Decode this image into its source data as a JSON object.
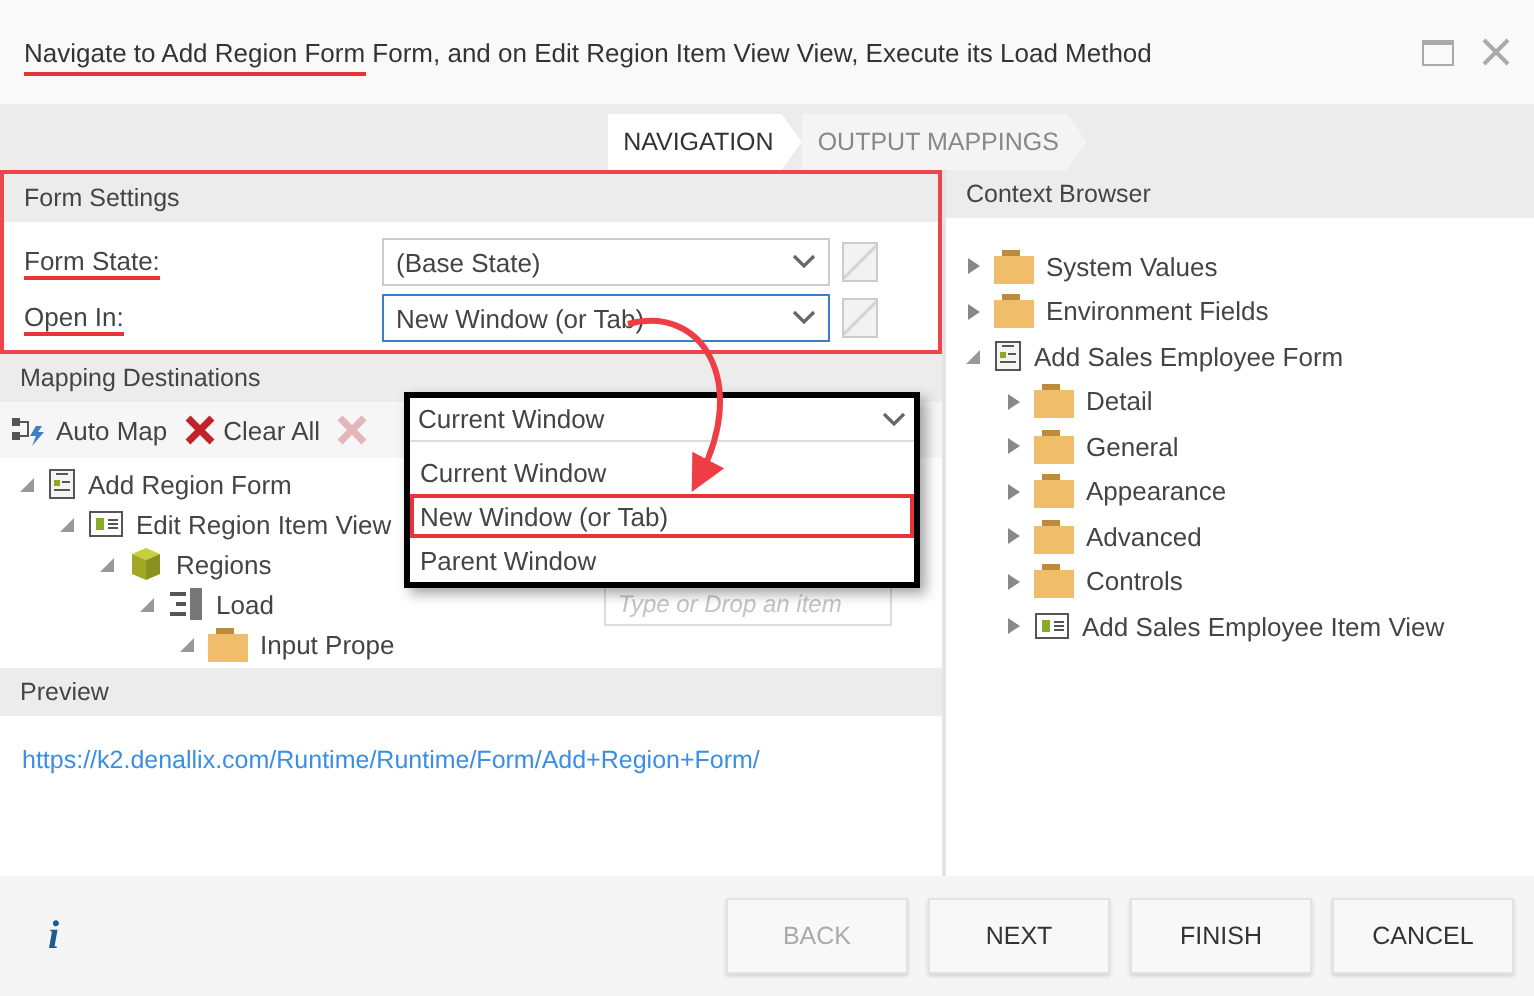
{
  "window": {
    "title_marked": "Navigate to Add Region Form",
    "title_rest": " Form, and on Edit Region Item View View, Execute its Load Method"
  },
  "steps": [
    {
      "label": "NAVIGATION",
      "selected": true
    },
    {
      "label": "OUTPUT MAPPINGS",
      "selected": false
    }
  ],
  "form_settings": {
    "title": "Form Settings",
    "highlighted": true,
    "fields": [
      {
        "label": "Form State:",
        "value": "(Base State)",
        "focused": false,
        "underlined": true
      },
      {
        "label": "Open In:",
        "value": "New Window (or Tab)",
        "focused": true,
        "underlined": true
      }
    ]
  },
  "dropdown": {
    "value": "Current Window",
    "options": [
      {
        "label": "Current Window",
        "highlighted": false
      },
      {
        "label": "New Window (or Tab)",
        "highlighted": true
      },
      {
        "label": "Parent Window",
        "highlighted": false
      }
    ]
  },
  "mapping": {
    "title": "Mapping Destinations",
    "toolbar": [
      {
        "label": "Auto Map",
        "kind": "automap",
        "disabled": false
      },
      {
        "label": "Clear All",
        "kind": "clear",
        "disabled": false
      },
      {
        "kind": "remove",
        "disabled": true
      }
    ],
    "tree": [
      {
        "label": "Add Region Form",
        "kind": "form",
        "children": [
          {
            "label": "Edit Region Item View",
            "kind": "view",
            "children": [
              {
                "label": "Regions",
                "kind": "object",
                "children": [
                  {
                    "label": "Load",
                    "kind": "method",
                    "children": [
                      {
                        "label": "Input Prope",
                        "kind": "folder"
                      }
                    ]
                  }
                ]
              }
            ]
          }
        ]
      }
    ],
    "drop_placeholder": "Type or Drop an item"
  },
  "preview": {
    "title": "Preview",
    "url": "https://k2.denallix.com/Runtime/Runtime/Form/Add+Region+Form/"
  },
  "context": {
    "title": "Context Browser",
    "tree": [
      {
        "label": "System Values",
        "kind": "folder",
        "expanded": false
      },
      {
        "label": "Environment Fields",
        "kind": "folder",
        "expanded": false
      },
      {
        "label": "Add Sales Employee Form",
        "kind": "form",
        "expanded": true,
        "children": [
          {
            "label": "Detail",
            "kind": "folder",
            "expanded": false
          },
          {
            "label": "General",
            "kind": "folder",
            "expanded": false
          },
          {
            "label": "Appearance",
            "kind": "folder",
            "expanded": false
          },
          {
            "label": "Advanced",
            "kind": "folder",
            "expanded": false
          },
          {
            "label": "Controls",
            "kind": "folder",
            "expanded": false
          },
          {
            "label": "Add Sales Employee Item View",
            "kind": "view",
            "expanded": false
          }
        ]
      }
    ]
  },
  "footer": {
    "info": "i"
  },
  "buttons": [
    {
      "label": "BACK",
      "disabled": true
    },
    {
      "label": "NEXT",
      "disabled": false
    },
    {
      "label": "FINISH",
      "disabled": false
    },
    {
      "label": "CANCEL",
      "disabled": false
    }
  ]
}
